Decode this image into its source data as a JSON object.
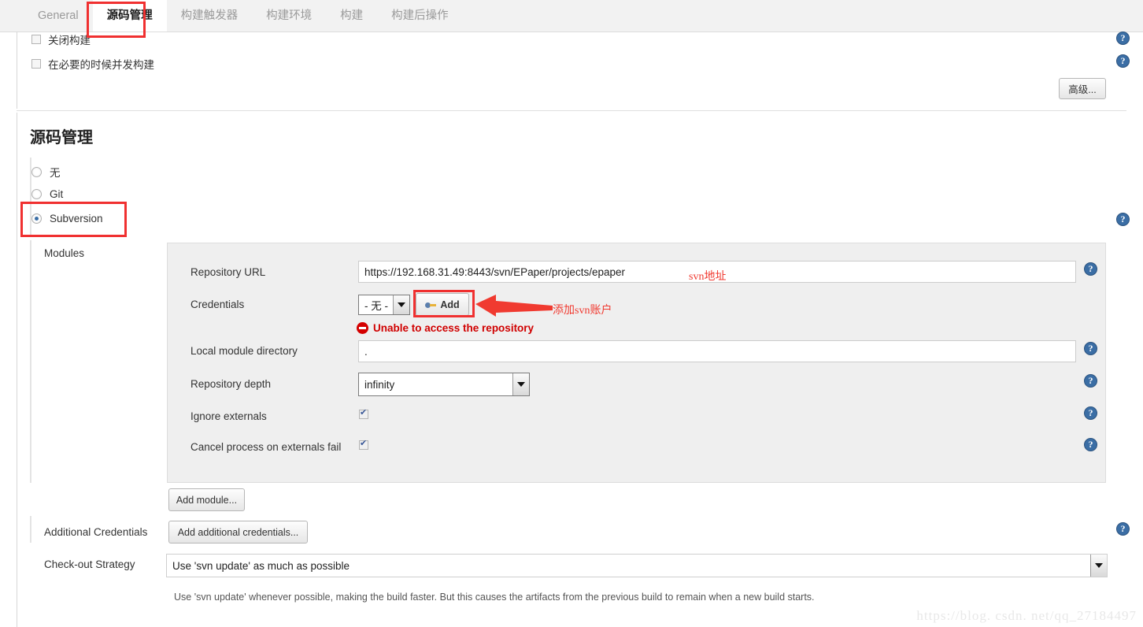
{
  "tabs": [
    {
      "label": "General",
      "active": false
    },
    {
      "label": "源码管理",
      "active": true
    },
    {
      "label": "构建触发器",
      "active": false
    },
    {
      "label": "构建环境",
      "active": false
    },
    {
      "label": "构建",
      "active": false
    },
    {
      "label": "构建后操作",
      "active": false
    }
  ],
  "top_options": [
    {
      "label": "关闭构建",
      "checked": false
    },
    {
      "label": "在必要的时候并发构建",
      "checked": false
    }
  ],
  "advanced_button": "高级...",
  "section": {
    "title": "源码管理",
    "scm_choices": [
      {
        "label": "无",
        "selected": false
      },
      {
        "label": "Git",
        "selected": false
      },
      {
        "label": "Subversion",
        "selected": true
      }
    ]
  },
  "modules": {
    "label": "Modules",
    "repository_url": {
      "label": "Repository URL",
      "value": "https://192.168.31.49:8443/svn/EPaper/projects/epaper"
    },
    "credentials": {
      "label": "Credentials",
      "selected": "- 无 -",
      "add_button": "Add",
      "error": "Unable to access the repository"
    },
    "local_module_directory": {
      "label": "Local module directory",
      "value": "."
    },
    "repository_depth": {
      "label": "Repository depth",
      "selected": "infinity"
    },
    "ignore_externals": {
      "label": "Ignore externals",
      "checked": true
    },
    "cancel_process": {
      "label": "Cancel process on externals fail",
      "checked": true
    },
    "add_module_button": "Add module..."
  },
  "additional_credentials": {
    "label": "Additional Credentials",
    "button": "Add additional credentials..."
  },
  "checkout_strategy": {
    "label": "Check-out Strategy",
    "selected": "Use 'svn update' as much as possible",
    "description": "Use 'svn update' whenever possible, making the build faster. But this causes the artifacts from the previous build to remain when a new build starts."
  },
  "annotations": {
    "svn_address": "svn地址",
    "add_svn_account": "添加svn账户"
  },
  "watermark": "https://blog. csdn. net/qq_27184497",
  "help_icon_glyph": "?"
}
